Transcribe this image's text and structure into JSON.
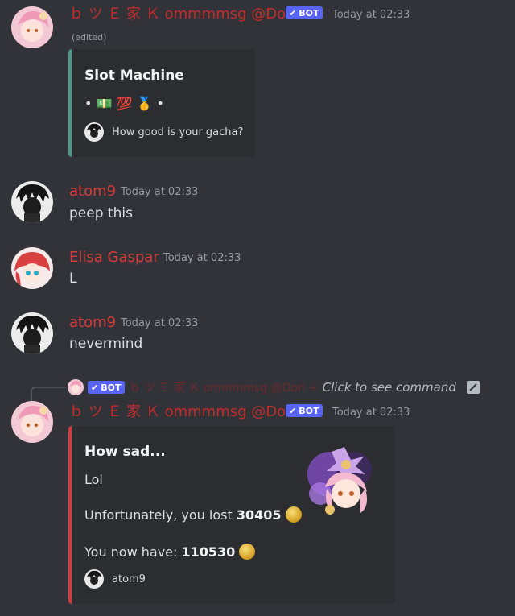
{
  "messages": [
    {
      "username": "ｂ ツ Ｅ 家 Ｋ ommmmsg @Dori +",
      "bot_label": "BOT",
      "timestamp": "Today at 02:33",
      "edited": "(edited)",
      "embed": {
        "title": "Slot Machine",
        "slots": "• 💵 💯 🥇 •",
        "footer": "How good is your gacha?"
      }
    },
    {
      "username": "atom9",
      "timestamp": "Today at 02:33",
      "text": "peep this"
    },
    {
      "username": "Elisa Gaspar",
      "timestamp": "Today at 02:33",
      "text": "L"
    },
    {
      "username": "atom9",
      "timestamp": "Today at 02:33",
      "text": "nevermind"
    },
    {
      "reply": {
        "bot_label": "BOT",
        "username": "ｂ ツ Ｅ 家 Ｋ ommmmsg @Dori +",
        "command_text": "Click to see command"
      },
      "username": "ｂ ツ Ｅ 家 Ｋ ommmmsg @Dori +",
      "bot_label": "BOT",
      "timestamp": "Today at 02:33",
      "embed": {
        "title": "How sad...",
        "line1": "Lol",
        "lost_prefix": "Unfortunately, you lost ",
        "lost_amount": "30405",
        "have_prefix": "You now have: ",
        "have_amount": "110530",
        "footer": "atom9",
        "accent": "#da373c"
      }
    }
  ],
  "colors": {
    "background": "#313338",
    "embed_bg": "#2b2d31",
    "slot_accent": "#4a9a8c",
    "result_accent": "#da373c",
    "bot_tag": "#5865f2",
    "bot_username": "#c22d2d",
    "user_username": "#d63b3b"
  }
}
